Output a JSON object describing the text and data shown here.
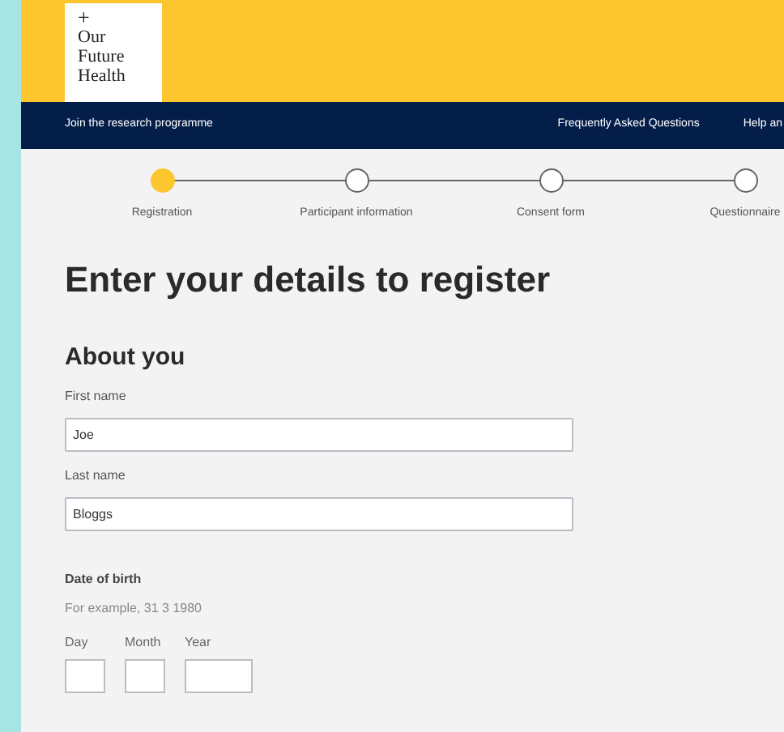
{
  "logo": {
    "mark": "+",
    "text": "Our Future Health"
  },
  "nav": {
    "links": [
      "Join the research programme"
    ],
    "right_links": [
      "Frequently Asked Questions",
      "Help an"
    ]
  },
  "steps": [
    {
      "label": "Registration",
      "selected": true
    },
    {
      "label": "Participant information",
      "selected": false
    },
    {
      "label": "Consent form",
      "selected": false
    },
    {
      "label": "Questionnaire",
      "selected": false
    }
  ],
  "title": "Enter your details to register",
  "section": "About you",
  "fields": [
    {
      "label": "First name",
      "value": "Joe"
    },
    {
      "label": "Last name",
      "value": "Bloggs"
    }
  ],
  "date_of_birth": {
    "legend": "Date of birth",
    "hint": "For example, 31 3 1980",
    "parts": [
      {
        "label": "Day",
        "kind": "short"
      },
      {
        "label": "Month",
        "kind": "short"
      },
      {
        "label": "Year",
        "kind": "long"
      }
    ]
  }
}
